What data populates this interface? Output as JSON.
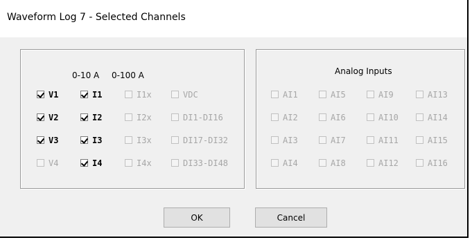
{
  "window": {
    "title": "Waveform Log 7 - Selected Channels"
  },
  "left_group": {
    "header_0_10": "0-10 A",
    "header_0_100": "0-100 A",
    "rows": [
      [
        {
          "label": "V1",
          "checked": true,
          "enabled": true
        },
        {
          "label": "I1",
          "checked": true,
          "enabled": true
        },
        {
          "label": "I1x",
          "checked": false,
          "enabled": false
        },
        {
          "label": "VDC",
          "checked": false,
          "enabled": false
        }
      ],
      [
        {
          "label": "V2",
          "checked": true,
          "enabled": true
        },
        {
          "label": "I2",
          "checked": true,
          "enabled": true
        },
        {
          "label": "I2x",
          "checked": false,
          "enabled": false
        },
        {
          "label": "DI1-DI16",
          "checked": false,
          "enabled": false
        }
      ],
      [
        {
          "label": "V3",
          "checked": true,
          "enabled": true
        },
        {
          "label": "I3",
          "checked": true,
          "enabled": true
        },
        {
          "label": "I3x",
          "checked": false,
          "enabled": false
        },
        {
          "label": "DI17-DI32",
          "checked": false,
          "enabled": false
        }
      ],
      [
        {
          "label": "V4",
          "checked": false,
          "enabled": false
        },
        {
          "label": "I4",
          "checked": true,
          "enabled": true
        },
        {
          "label": "I4x",
          "checked": false,
          "enabled": false
        },
        {
          "label": "DI33-DI48",
          "checked": false,
          "enabled": false
        }
      ]
    ]
  },
  "right_group": {
    "header": "Analog Inputs",
    "rows": [
      [
        {
          "label": "AI1",
          "checked": false,
          "enabled": false
        },
        {
          "label": "AI5",
          "checked": false,
          "enabled": false
        },
        {
          "label": "AI9",
          "checked": false,
          "enabled": false
        },
        {
          "label": "AI13",
          "checked": false,
          "enabled": false
        }
      ],
      [
        {
          "label": "AI2",
          "checked": false,
          "enabled": false
        },
        {
          "label": "AI6",
          "checked": false,
          "enabled": false
        },
        {
          "label": "AI10",
          "checked": false,
          "enabled": false
        },
        {
          "label": "AI14",
          "checked": false,
          "enabled": false
        }
      ],
      [
        {
          "label": "AI3",
          "checked": false,
          "enabled": false
        },
        {
          "label": "AI7",
          "checked": false,
          "enabled": false
        },
        {
          "label": "AI11",
          "checked": false,
          "enabled": false
        },
        {
          "label": "AI15",
          "checked": false,
          "enabled": false
        }
      ],
      [
        {
          "label": "AI4",
          "checked": false,
          "enabled": false
        },
        {
          "label": "AI8",
          "checked": false,
          "enabled": false
        },
        {
          "label": "AI12",
          "checked": false,
          "enabled": false
        },
        {
          "label": "AI16",
          "checked": false,
          "enabled": false
        }
      ]
    ]
  },
  "buttons": {
    "ok": "OK",
    "cancel": "Cancel"
  }
}
